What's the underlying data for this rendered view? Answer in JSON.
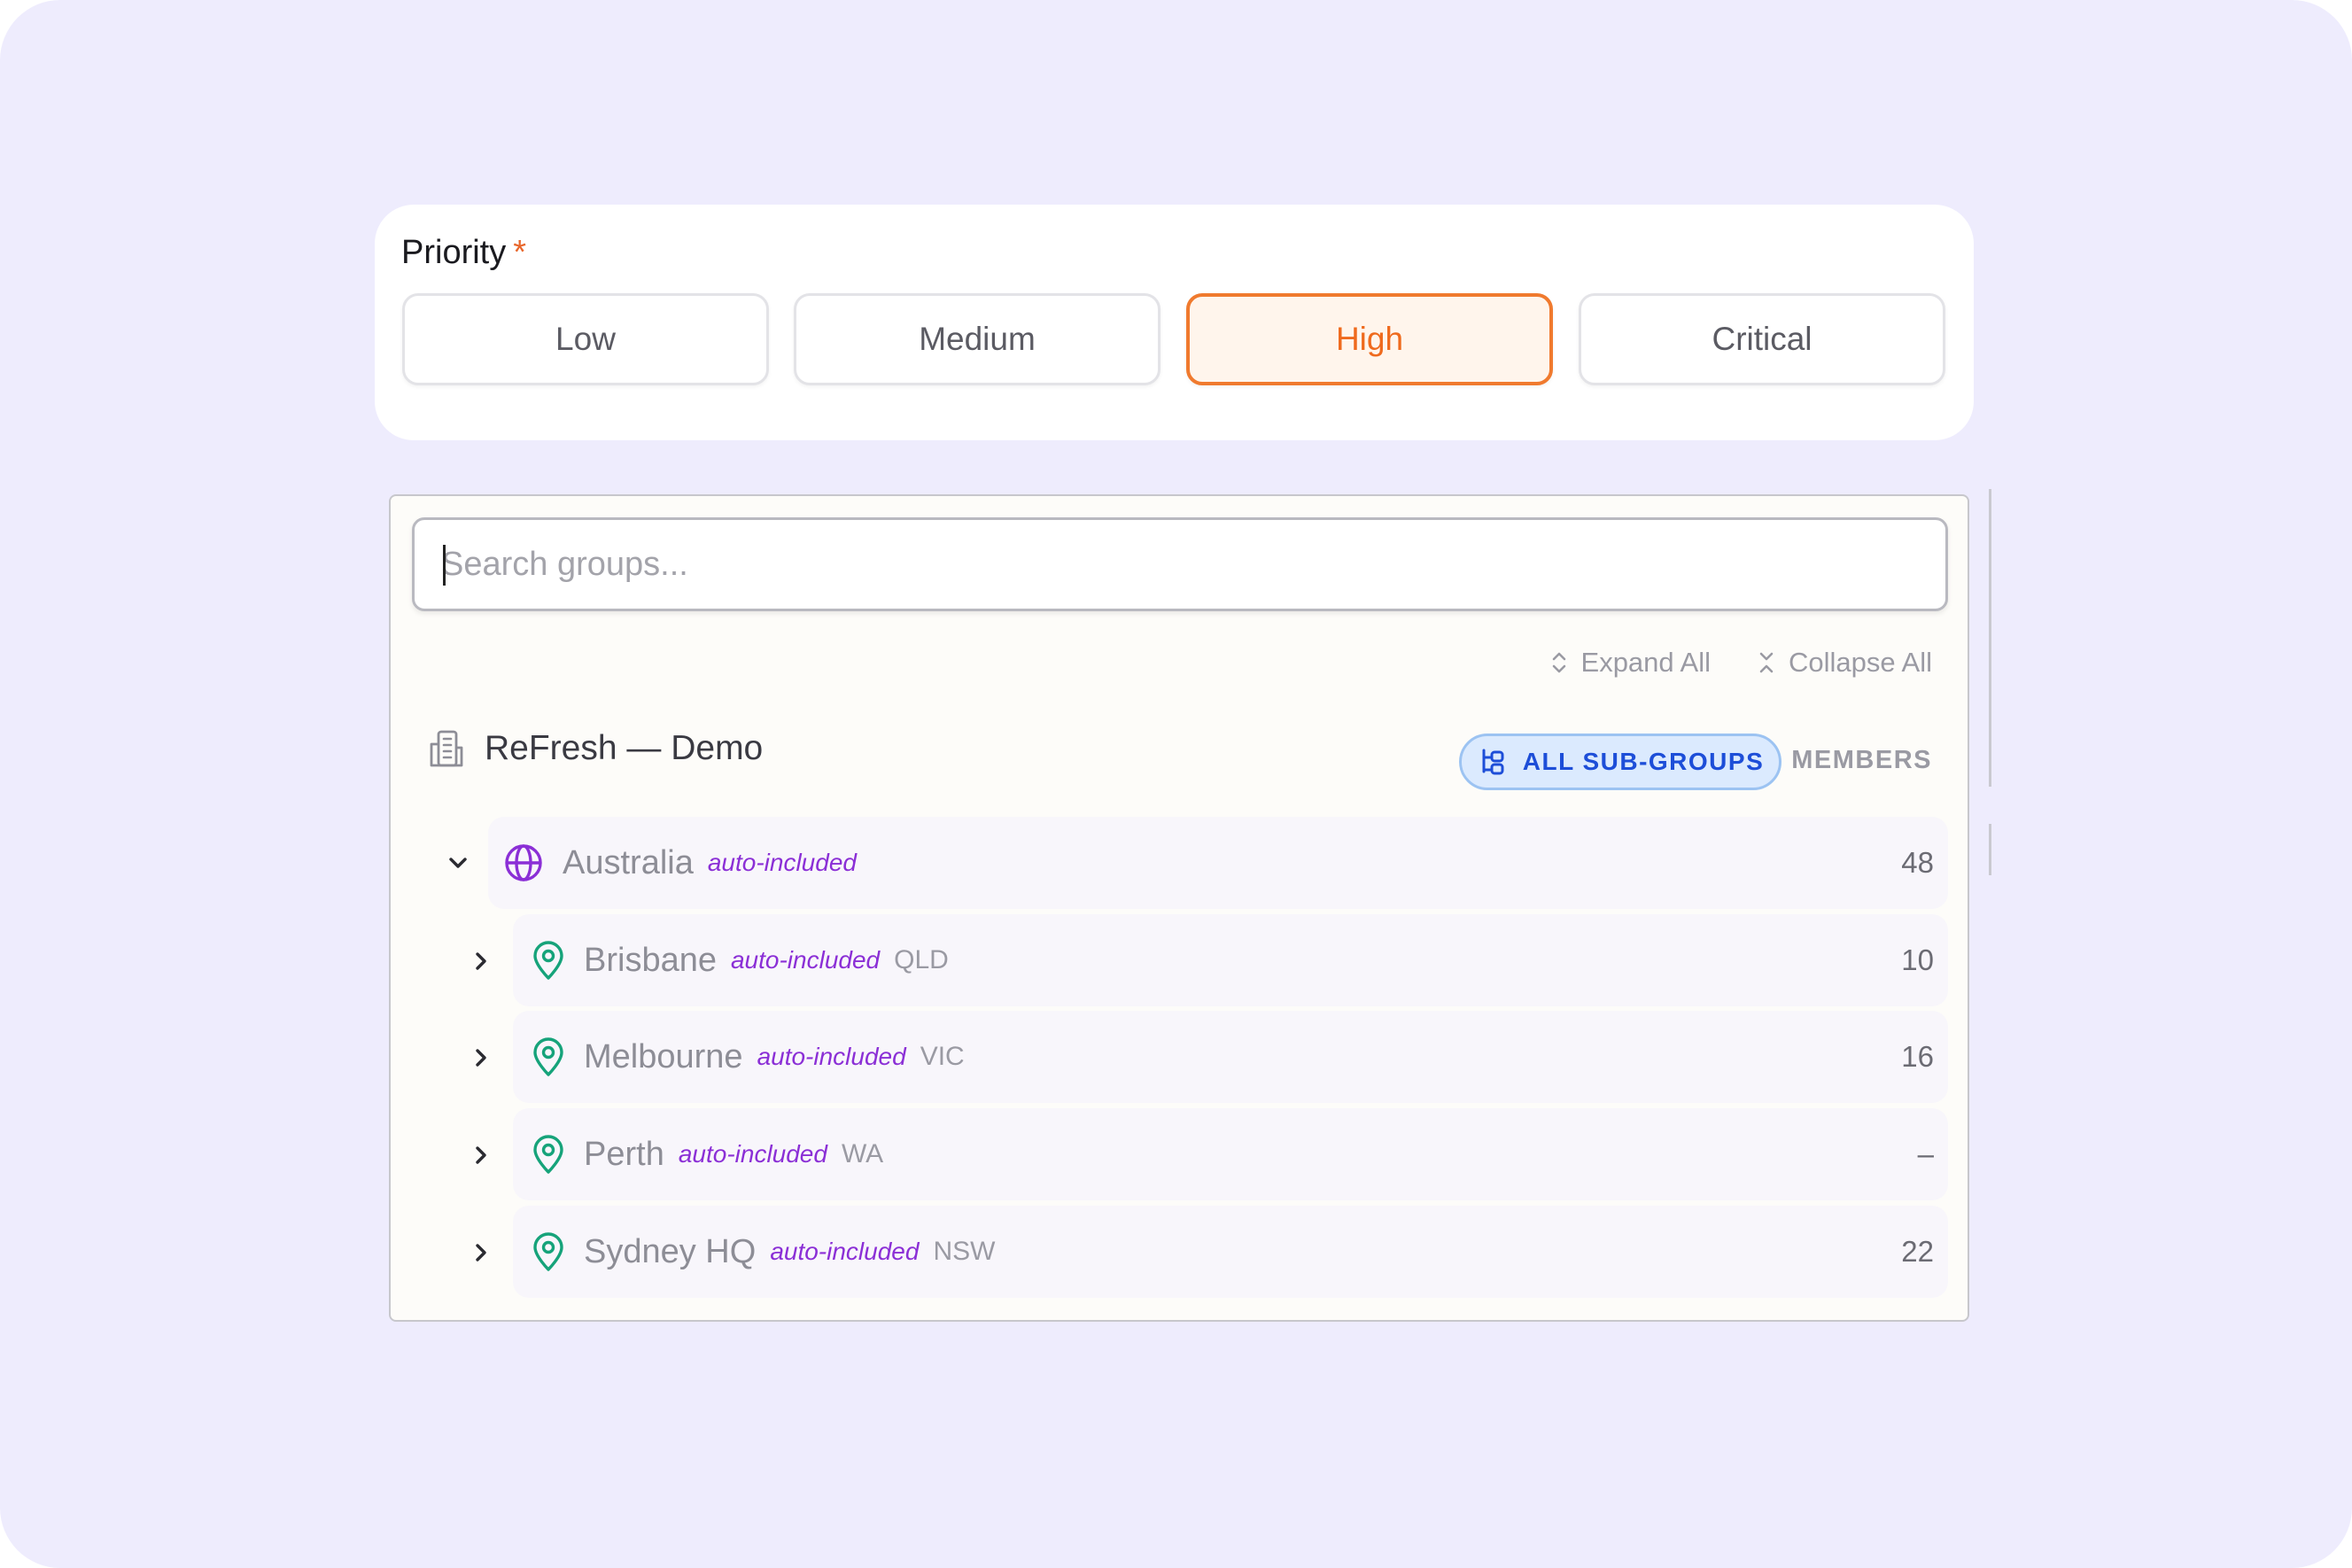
{
  "priority": {
    "label": "Priority",
    "required_mark": "*",
    "options": [
      "Low",
      "Medium",
      "High",
      "Critical"
    ],
    "selected": "High",
    "accent_color": "#f07a2e"
  },
  "groups": {
    "search_placeholder": "Search groups...",
    "expand_all_label": "Expand All",
    "collapse_all_label": "Collapse All",
    "root": {
      "name": "ReFresh — Demo",
      "subgroups_badge": "ALL SUB-GROUPS",
      "members_header": "MEMBERS",
      "icon": "building-icon"
    },
    "country": {
      "name": "Australia",
      "tag": "auto-included",
      "count": "48",
      "icon": "globe-icon",
      "expanded": true
    },
    "cities": [
      {
        "name": "Brisbane",
        "tag": "auto-included",
        "code": "QLD",
        "count": "10",
        "icon": "map-pin-icon"
      },
      {
        "name": "Melbourne",
        "tag": "auto-included",
        "code": "VIC",
        "count": "16",
        "icon": "map-pin-icon"
      },
      {
        "name": "Perth",
        "tag": "auto-included",
        "code": "WA",
        "count": "–",
        "icon": "map-pin-icon"
      },
      {
        "name": "Sydney HQ",
        "tag": "auto-included",
        "code": "NSW",
        "count": "22",
        "icon": "map-pin-icon"
      }
    ],
    "colors": {
      "tag_purple": "#8b2fd6",
      "pin_green": "#16a34a",
      "badge_blue": "#1d4ed8"
    }
  }
}
